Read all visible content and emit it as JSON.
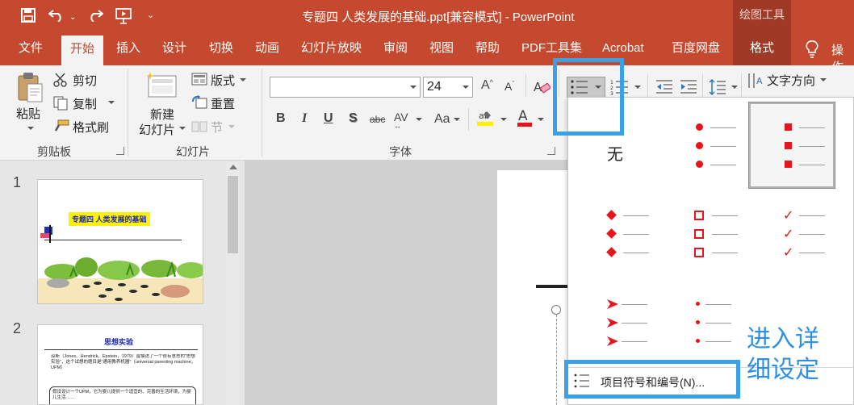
{
  "titlebar": {
    "document_title": "专题四 人类发展的基础.ppt[兼容模式] - PowerPoint",
    "context_group": "绘图工具"
  },
  "tabs": [
    "文件",
    "开始",
    "插入",
    "设计",
    "切换",
    "动画",
    "幻灯片放映",
    "审阅",
    "视图",
    "帮助",
    "PDF工具集",
    "Acrobat",
    "百度网盘",
    "格式"
  ],
  "tell_me": "操作",
  "ribbon": {
    "clipboard": {
      "paste": "粘贴",
      "cut": "剪切",
      "copy": "复制",
      "format_painter": "格式刷",
      "group_label": "剪贴板"
    },
    "slides": {
      "new_slide_line1": "新建",
      "new_slide_line2": "幻灯片",
      "layout": "版式",
      "reset": "重置",
      "section": "节",
      "group_label": "幻灯片"
    },
    "font": {
      "font_name": "",
      "font_size": "24",
      "group_label": "字体"
    },
    "paragraph": {
      "text_direction": "文字方向"
    }
  },
  "bullet_gallery": {
    "none_label": "无",
    "footer_item": "项目符号和编号(N)...",
    "styles": [
      "none",
      "filled-round",
      "filled-square",
      "diamond",
      "hollow-square",
      "checkmark",
      "arrow",
      "small-dot"
    ]
  },
  "thumbnails": {
    "slide1": {
      "number": "1",
      "title": "专题四   人类发展的基础"
    },
    "slide2": {
      "number": "2",
      "title": "思想实验",
      "bullet_text": "琼斯（Jones、Hendrick、Epstein，1979）曾描述了一个很有意思的\"思想实验\"，这个试想的题目是\"通用教养机器\"（universal parenting machine，UPM）",
      "body_text": "假设设计一个UPM，它为婴儿提供一个适宜的、完善的生活环境，为婴儿生活……"
    }
  },
  "annotation": {
    "line1": "进入详",
    "line2": "细设定"
  },
  "colors": {
    "brand": "#c4492f",
    "bullet_red": "#e8141c",
    "highlight": "#3aa0e8"
  }
}
